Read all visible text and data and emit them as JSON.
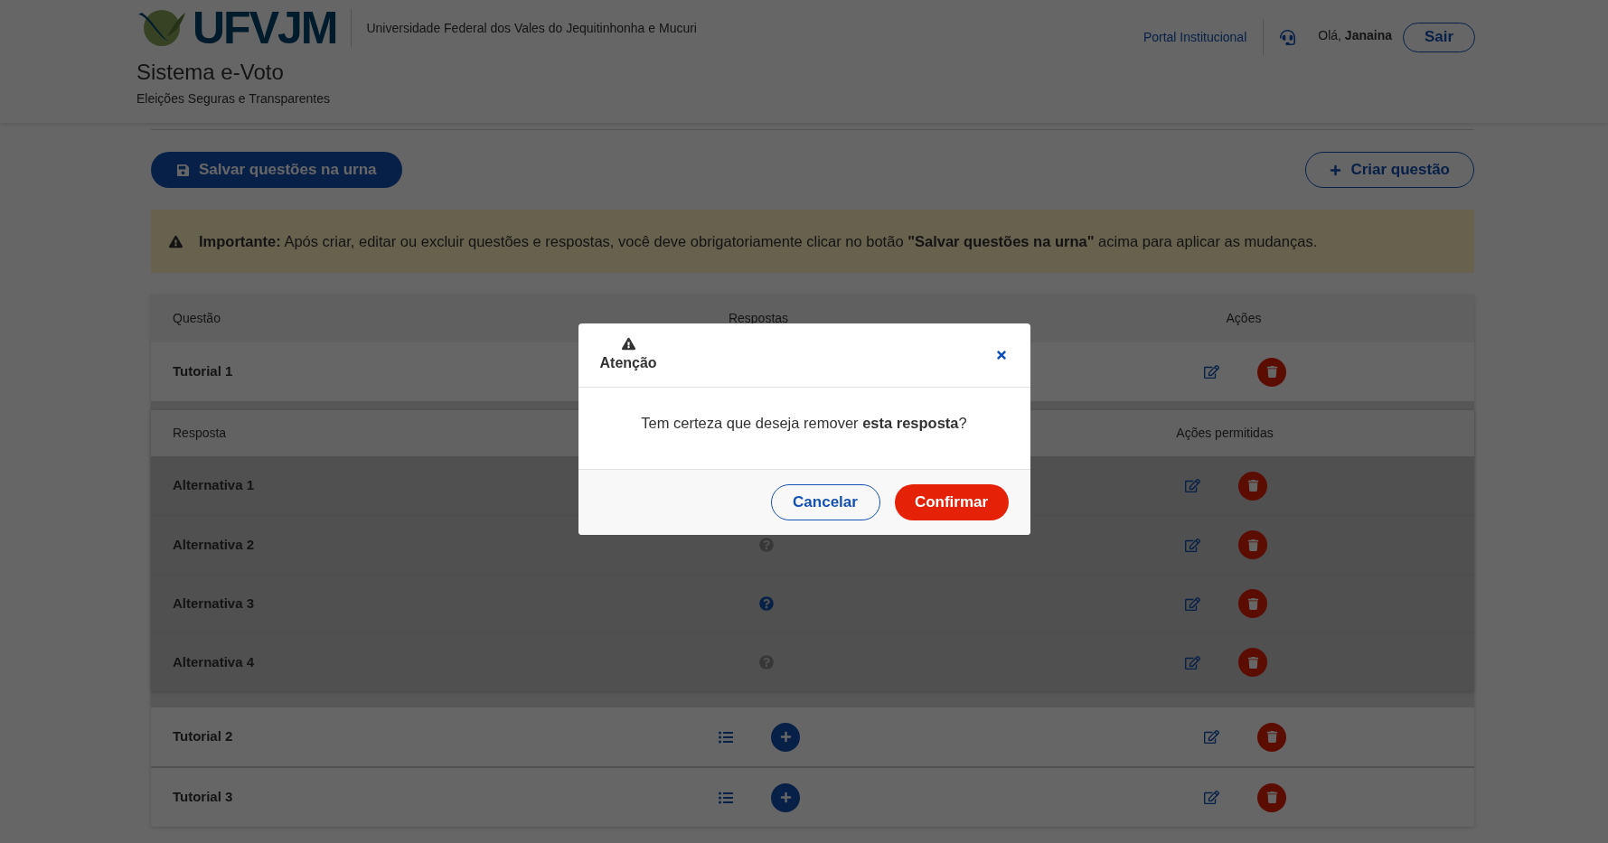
{
  "header": {
    "logo": "UFVJM",
    "university": "Universidade Federal dos Vales do Jequitinhonha e Mucuri",
    "app_title": "Sistema e-Voto",
    "app_subtitle": "Eleições Seguras e Transparentes",
    "portal_link": "Portal Institucional",
    "greeting": "Olá,",
    "user": "Janaina",
    "logout": "Sair"
  },
  "toolbar": {
    "save_button": "Salvar questões na urna",
    "create_button": "Criar questão"
  },
  "alert": {
    "text": "**Importante:** Após criar, editar ou excluir questões e respostas, você deve obrigatoriamente clicar no botão **\"Salvar questões na urna\"** acima para aplicar as mudanças."
  },
  "table": {
    "columns": [
      "Questão",
      "Respostas",
      "Ações"
    ],
    "answer_columns": [
      "Resposta",
      "Ações permitidas"
    ],
    "rows": [
      {
        "title": "Tutorial 1",
        "expanded": true,
        "answers": [
          {
            "title": "Alternativa 1"
          },
          {
            "title": "Alternativa 2",
            "marked": false
          },
          {
            "title": "Alternativa 3",
            "marked": true
          },
          {
            "title": "Alternativa 4",
            "marked": false
          }
        ]
      },
      {
        "title": "Tutorial 2",
        "expanded": false
      },
      {
        "title": "Tutorial 3",
        "expanded": false
      }
    ]
  },
  "modal": {
    "open": true,
    "title": "Atenção",
    "message": "Tem certeza que deseja remover **esta resposta**?",
    "cancel": "Cancelar",
    "confirm": "Confirmar"
  }
}
